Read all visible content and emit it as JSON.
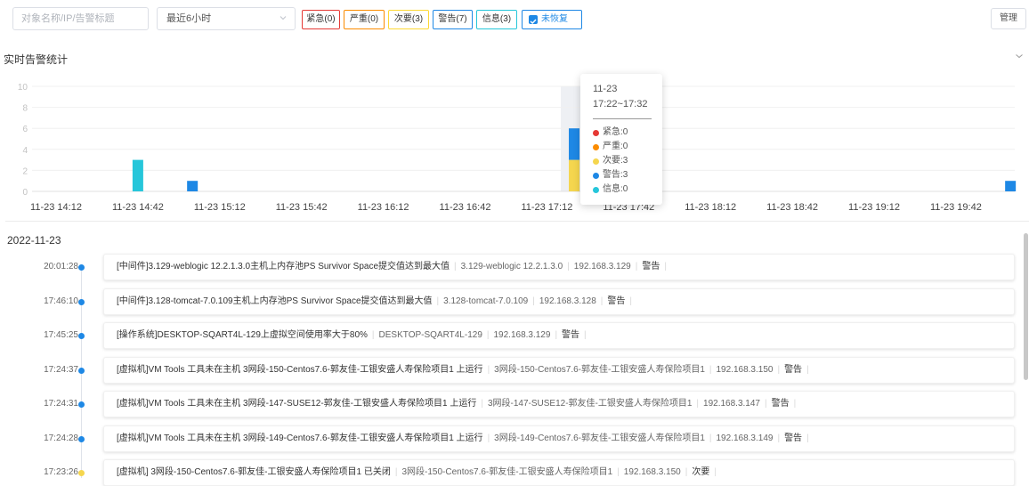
{
  "filter": {
    "search_placeholder": "对象名称/IP/告警标题",
    "time_range": "最近6小时",
    "levels": [
      {
        "label": "紧急(0)",
        "color": "#e53935"
      },
      {
        "label": "严重(0)",
        "color": "#fb8c00"
      },
      {
        "label": "次要(3)",
        "color": "#fdd835"
      },
      {
        "label": "警告(7)",
        "color": "#1e88e5"
      },
      {
        "label": "信息(3)",
        "color": "#26c6da"
      }
    ],
    "unrecovered_label": "未恢复",
    "unrecovered_checked": true,
    "manage_label": "管理"
  },
  "section_title": "实时告警统计",
  "chart_data": {
    "type": "bar",
    "stacked": true,
    "yticks": [
      "10",
      "8",
      "6",
      "4",
      "2",
      "0"
    ],
    "ylim": [
      0,
      10
    ],
    "grid": true,
    "xticks": [
      "11-23 14:12",
      "11-23 14:42",
      "11-23 15:12",
      "11-23 15:42",
      "11-23 16:12",
      "11-23 16:42",
      "11-23 17:12",
      "11-23 17:42",
      "11-23 18:12",
      "11-23 18:42",
      "11-23 19:12",
      "11-23 19:42"
    ],
    "series": [
      {
        "name": "紧急",
        "color": "#e53935",
        "points": []
      },
      {
        "name": "严重",
        "color": "#fb8c00",
        "points": []
      },
      {
        "name": "次要",
        "color": "#f5d64e",
        "points": [
          {
            "x": "11-23 17:22",
            "y": 3
          }
        ]
      },
      {
        "name": "警告",
        "color": "#1e88e5",
        "points": [
          {
            "x": "11-23 15:02",
            "y": 1
          },
          {
            "x": "11-23 17:22",
            "y": 3
          },
          {
            "x": "11-23 20:02",
            "y": 1
          }
        ]
      },
      {
        "name": "信息",
        "color": "#26c6da",
        "points": [
          {
            "x": "11-23 14:42",
            "y": 3
          }
        ]
      }
    ],
    "highlight_x": "11-23 17:22"
  },
  "tooltip": {
    "date": "11-23",
    "range": "17:22~17:32",
    "items": [
      {
        "label": "紧急",
        "value": "0",
        "color": "#e53935"
      },
      {
        "label": "严重",
        "value": "0",
        "color": "#fb8c00"
      },
      {
        "label": "次要",
        "value": "3",
        "color": "#f5d64e"
      },
      {
        "label": "警告",
        "value": "3",
        "color": "#1e88e5"
      },
      {
        "label": "信息",
        "value": "0",
        "color": "#26c6da"
      }
    ]
  },
  "timeline": {
    "date": "2022-11-23",
    "events": [
      {
        "time": "20:01:28",
        "dot": "#1e88e5",
        "title": "[中间件]3.129-weblogic 12.2.1.3.0主机上内存池PS Survivor Space提交值达到最大值",
        "object": "3.129-weblogic 12.2.1.3.0",
        "ip": "192.168.3.129",
        "level": "警告"
      },
      {
        "time": "17:46:10",
        "dot": "#1e88e5",
        "title": "[中间件]3.128-tomcat-7.0.109主机上内存池PS Survivor Space提交值达到最大值",
        "object": "3.128-tomcat-7.0.109",
        "ip": "192.168.3.128",
        "level": "警告"
      },
      {
        "time": "17:45:25",
        "dot": "#1e88e5",
        "title": "[操作系统]DESKTOP-SQART4L-129上虚拟空间使用率大于80%",
        "object": "DESKTOP-SQART4L-129",
        "ip": "192.168.3.129",
        "level": "警告"
      },
      {
        "time": "17:24:37",
        "dot": "#1e88e5",
        "title": "[虚拟机]VM Tools 工具未在主机 3网段-150-Centos7.6-郭友佳-工银安盛人寿保险项目1 上运行",
        "object": "3网段-150-Centos7.6-郭友佳-工银安盛人寿保险项目1",
        "ip": "192.168.3.150",
        "level": "警告"
      },
      {
        "time": "17:24:31",
        "dot": "#1e88e5",
        "title": "[虚拟机]VM Tools 工具未在主机 3网段-147-SUSE12-郭友佳-工银安盛人寿保险项目1 上运行",
        "object": "3网段-147-SUSE12-郭友佳-工银安盛人寿保险项目1",
        "ip": "192.168.3.147",
        "level": "警告"
      },
      {
        "time": "17:24:28",
        "dot": "#1e88e5",
        "title": "[虚拟机]VM Tools 工具未在主机 3网段-149-Centos7.6-郭友佳-工银安盛人寿保险项目1 上运行",
        "object": "3网段-149-Centos7.6-郭友佳-工银安盛人寿保险项目1",
        "ip": "192.168.3.149",
        "level": "警告"
      },
      {
        "time": "17:23:26",
        "dot": "#f5d64e",
        "title": "[虚拟机] 3网段-150-Centos7.6-郭友佳-工银安盛人寿保险项目1 已关闭",
        "object": "3网段-150-Centos7.6-郭友佳-工银安盛人寿保险项目1",
        "ip": "192.168.3.150",
        "level": "次要"
      }
    ]
  }
}
